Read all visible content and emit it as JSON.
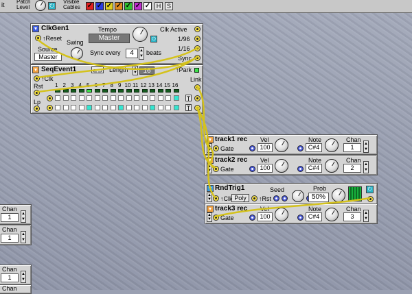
{
  "topbar": {
    "left_label": "it",
    "patch_level_label": "Patch Level",
    "visible_cables_label": "Visible Cables",
    "h_button": "H",
    "s_button": "S",
    "checks": [
      "✓",
      "✓",
      "✓",
      "✓",
      "✓",
      "✓",
      "✓"
    ]
  },
  "clkgen": {
    "title": "ClkGen1",
    "reset_label": "Reset",
    "tempo_label": "Tempo",
    "tempo_value": "Master",
    "clk_active_label": "Clk Active",
    "source_label": "Source",
    "source_value": "Master",
    "swing_label": "Swing",
    "sync_every_label": "Sync every",
    "sync_every_value": "4",
    "beats_label": "beats",
    "out_1_96": "1/96",
    "out_1_16": "1/16",
    "sync_out": "Sync"
  },
  "seqevent": {
    "title": "SeqEvent1",
    "length_label": "Length",
    "length_value": "16",
    "park_label": "Park",
    "clk_label": "Clk",
    "rst_label": "Rst",
    "link_label": "Link",
    "lp_label": "Lp",
    "steps": [
      "1",
      "2",
      "3",
      "4",
      "5",
      "6",
      "7",
      "8",
      "9",
      "10",
      "11",
      "12",
      "13",
      "14",
      "15",
      "16"
    ],
    "row1": [
      0,
      0,
      0,
      0,
      0,
      0,
      0,
      0,
      0,
      0,
      0,
      0,
      0,
      0,
      0,
      1
    ],
    "row2": [
      0,
      0,
      0,
      0,
      1,
      0,
      0,
      0,
      1,
      0,
      0,
      0,
      1,
      0,
      0,
      1
    ],
    "t_label": "T",
    "led_active_step": 4
  },
  "track1": {
    "title": "track1 rec",
    "gate_label": "Gate",
    "vel_label": "Vel",
    "vel_value": "100",
    "note_label": "Note",
    "note_value": "C#4",
    "chan_label": "Chan",
    "chan_value": "1"
  },
  "track2": {
    "title": "track2 rec",
    "gate_label": "Gate",
    "vel_label": "Vel",
    "vel_value": "100",
    "note_label": "Note",
    "note_value": "C#4",
    "chan_label": "Chan",
    "chan_value": "2"
  },
  "rndtrig": {
    "title": "RndTrig1",
    "seed_label": "Seed",
    "prob_label": "Prob",
    "prob_value": "50%",
    "clk_label": "Clk",
    "mode_value": "Poly",
    "rst_label": "Rst"
  },
  "track3": {
    "title": "track3 rec",
    "gate_label": "Gate",
    "vel_label": "Vel",
    "vel_value": "100",
    "note_label": "Note",
    "note_value": "C#4",
    "chan_label": "Chan",
    "chan_value": "3"
  },
  "left_chan_modules": [
    {
      "label": "Chan",
      "value": "1"
    },
    {
      "label": "Chan",
      "value": "1"
    },
    {
      "label": "Chan",
      "value": "1"
    },
    {
      "label": "Chan",
      "value": ""
    }
  ],
  "colors": {
    "cable": "#d4c21c",
    "active_cell": "#34e6d0",
    "led_on": "#3de04a"
  }
}
